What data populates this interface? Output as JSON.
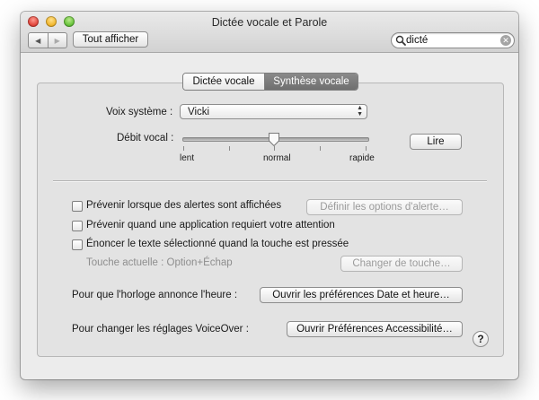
{
  "window": {
    "title": "Dictée vocale et Parole",
    "show_all_label": "Tout afficher",
    "nav_back": "◀",
    "nav_forward": "▶"
  },
  "search": {
    "value": "dicté",
    "placeholder": ""
  },
  "tabs": [
    {
      "label": "Dictée vocale",
      "active": false
    },
    {
      "label": "Synthèse vocale",
      "active": true
    }
  ],
  "voice": {
    "label": "Voix système :",
    "selected": "Vicki"
  },
  "speech_rate": {
    "label": "Débit vocal :",
    "min_label": "lent",
    "mid_label": "normal",
    "max_label": "rapide",
    "value": 0.5,
    "play_label": "Lire"
  },
  "options": {
    "alerts": {
      "label": "Prévenir lorsque des alertes sont affichées",
      "checked": false,
      "button": "Définir les options d'alerte…"
    },
    "app_attention": {
      "label": "Prévenir quand une application requiert votre attention",
      "checked": false
    },
    "speak_selection": {
      "label": "Énoncer le texte sélectionné quand la touche est pressée",
      "checked": false
    },
    "current_key": "Touche actuelle : Option+Échap",
    "change_key_button": "Changer de touche…"
  },
  "clock": {
    "label": "Pour que l'horloge annonce l'heure :",
    "button": "Ouvrir les préférences Date et heure…"
  },
  "voiceover": {
    "label": "Pour changer les réglages VoiceOver :",
    "button": "Ouvrir Préférences Accessibilité…"
  },
  "help_label": "?",
  "colors": {
    "active_tab": "#7a7a7a",
    "panel": "#e3e3e3",
    "window": "#ececec"
  }
}
